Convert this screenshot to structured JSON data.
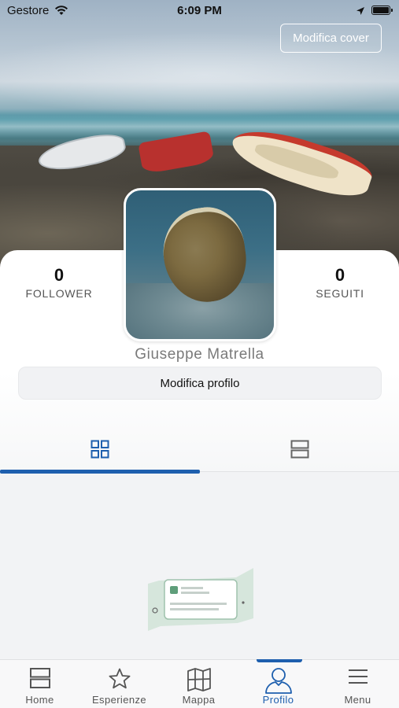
{
  "status_bar": {
    "carrier": "Gestore",
    "time": "6:09 PM"
  },
  "cover": {
    "edit_cover_label": "Modifica cover"
  },
  "profile": {
    "followers_count": "0",
    "followers_label": "FOLLOWER",
    "following_count": "0",
    "following_label": "SEGUITI",
    "name": "Giuseppe Matrella",
    "edit_profile_label": "Modifica profilo"
  },
  "tabs": [
    {
      "icon": "grid-view-icon",
      "active": true
    },
    {
      "icon": "list-view-icon",
      "active": false
    }
  ],
  "bottom_nav": {
    "items": [
      {
        "label": "Home",
        "icon": "home-icon"
      },
      {
        "label": "Esperienze",
        "icon": "star-icon"
      },
      {
        "label": "Mappa",
        "icon": "map-icon"
      },
      {
        "label": "Profilo",
        "icon": "profile-icon",
        "active": true
      },
      {
        "label": "Menu",
        "icon": "menu-icon"
      }
    ]
  },
  "colors": {
    "accent": "#1e5fae",
    "background": "#f2f3f5"
  }
}
